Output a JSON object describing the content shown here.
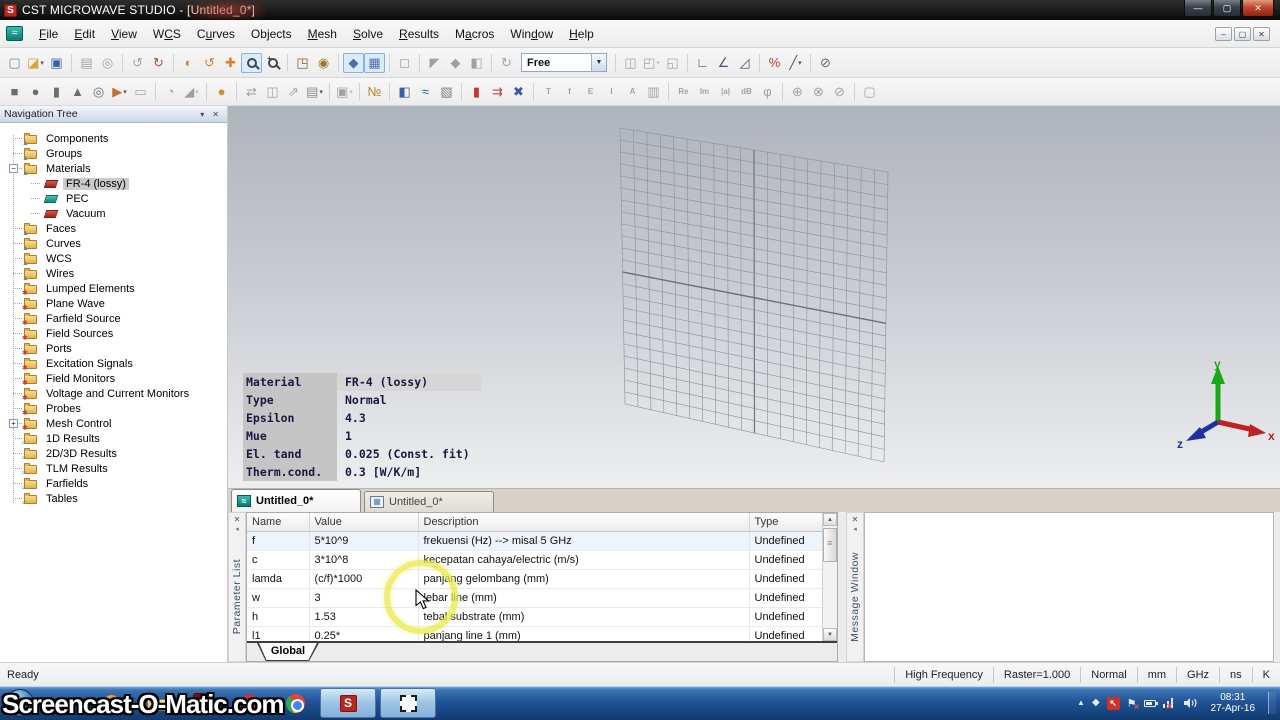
{
  "window": {
    "title": "CST MICROWAVE STUDIO - [Untitled_0*]",
    "controls": [
      "minimize",
      "restore",
      "close"
    ],
    "logo_color": "#c0271e"
  },
  "menu": {
    "items": [
      {
        "label": "File",
        "accel": 0
      },
      {
        "label": "Edit",
        "accel": 0
      },
      {
        "label": "View",
        "accel": 0
      },
      {
        "label": "WCS",
        "accel": 1
      },
      {
        "label": "Curves",
        "accel": 1
      },
      {
        "label": "Objects",
        "accel": 2
      },
      {
        "label": "Mesh",
        "accel": 0
      },
      {
        "label": "Solve",
        "accel": 0
      },
      {
        "label": "Results",
        "accel": 0
      },
      {
        "label": "Macros",
        "accel": 1
      },
      {
        "label": "Window",
        "accel": 3
      },
      {
        "label": "Help",
        "accel": 0
      }
    ]
  },
  "toolbar": {
    "mode_dropdown": "Free",
    "row1": [
      {
        "name": "new-project-icon",
        "glyph": "▢",
        "color": "#7a8694"
      },
      {
        "name": "open-project-icon",
        "glyph": "◪",
        "color": "#d9a43e",
        "caret": true
      },
      {
        "name": "save-project-icon",
        "glyph": "▣",
        "color": "#3a5fa8"
      },
      {
        "sep": true
      },
      {
        "name": "paste-icon",
        "glyph": "▤",
        "disabled": true
      },
      {
        "name": "delete-icon",
        "glyph": "◎",
        "disabled": true
      },
      {
        "sep": true
      },
      {
        "name": "undo-icon",
        "glyph": "↺",
        "disabled": true
      },
      {
        "name": "redo-icon",
        "glyph": "↻",
        "color": "#b5523a"
      },
      {
        "sep": true
      },
      {
        "name": "rotate-view-icon",
        "glyph": "◐",
        "color": "#d9822b"
      },
      {
        "name": "spin-view-icon",
        "glyph": "↺",
        "color": "#d9822b"
      },
      {
        "name": "pan-view-icon",
        "glyph": "✚",
        "color": "#d9822b"
      },
      {
        "name": "zoom-view-icon",
        "mag": true,
        "boxed": true
      },
      {
        "name": "zoom-window-icon",
        "mag": true,
        "plus": true
      },
      {
        "sep": true
      },
      {
        "name": "reset-view-icon",
        "glyph": "◳",
        "color": "#8a5a32"
      },
      {
        "name": "view-options-icon",
        "glyph": "◉",
        "color": "#9a7a2a"
      },
      {
        "sep": true
      },
      {
        "name": "normal-axis-icon",
        "glyph": "◆",
        "color": "#4a6fa5",
        "boxed": true
      },
      {
        "name": "grid-toggle-icon",
        "glyph": "▦",
        "color": "#4a6fa5",
        "boxed": true
      },
      {
        "sep": true
      },
      {
        "name": "wireframe-icon",
        "glyph": "◻",
        "disabled": true
      },
      {
        "sep": true
      },
      {
        "name": "pick-point-icon",
        "glyph": "◤",
        "disabled": true
      },
      {
        "name": "pick-edge-icon",
        "glyph": "◆",
        "disabled": true
      },
      {
        "name": "pick-face-icon",
        "glyph": "◧",
        "disabled": true
      },
      {
        "sep": true
      },
      {
        "name": "transform-view-icon",
        "glyph": "↻",
        "disabled": true
      },
      {
        "select": true
      },
      {
        "sep": true
      },
      {
        "name": "boolean-add-icon",
        "glyph": "◫",
        "disabled": true
      },
      {
        "name": "boolean-subtract-icon",
        "glyph": "◰",
        "disabled": true,
        "caret": true
      },
      {
        "name": "boolean-intersect-icon",
        "glyph": "◱",
        "disabled": true
      },
      {
        "sep": true
      },
      {
        "name": "wcs-icon",
        "glyph": "∟",
        "color": "#445577"
      },
      {
        "name": "align-wcs-icon",
        "glyph": "∠",
        "color": "#445577"
      },
      {
        "name": "wcs-face-icon",
        "glyph": "◿",
        "color": "#445577"
      },
      {
        "sep": true
      },
      {
        "name": "measure-icon",
        "glyph": "%",
        "color": "#c03a2e"
      },
      {
        "name": "pick-line-icon",
        "glyph": "╱",
        "color": "#555555",
        "caret": true
      },
      {
        "sep": true
      },
      {
        "name": "clear-picks-icon",
        "glyph": "⊘",
        "color": "#666666"
      }
    ],
    "row2": [
      {
        "name": "brick-icon",
        "glyph": "■",
        "color": "#686d75"
      },
      {
        "name": "sphere-icon",
        "glyph": "●",
        "color": "#686d75"
      },
      {
        "name": "cylinder-icon",
        "glyph": "▮",
        "color": "#686d75"
      },
      {
        "name": "cone-icon",
        "glyph": "▲",
        "color": "#686d75"
      },
      {
        "name": "torus-icon",
        "glyph": "◎",
        "color": "#686d75"
      },
      {
        "name": "extrude-curve-icon",
        "glyph": "▶",
        "color": "#c2702c",
        "caret": true
      },
      {
        "name": "sheet-icon",
        "glyph": "▭",
        "disabled": true
      },
      {
        "sep": true
      },
      {
        "name": "loft-icon",
        "glyph": "◔",
        "disabled": true
      },
      {
        "name": "shell-icon",
        "glyph": "◢",
        "disabled": true,
        "caret": true
      },
      {
        "sep": true
      },
      {
        "name": "new-material-icon",
        "glyph": "●",
        "color": "#d98a2b"
      },
      {
        "sep": true
      },
      {
        "name": "translate-icon",
        "glyph": "⇄",
        "disabled": true
      },
      {
        "name": "mirror-icon",
        "glyph": "◫",
        "disabled": true
      },
      {
        "name": "scale-icon",
        "glyph": "⇗",
        "disabled": true
      },
      {
        "name": "align-icon",
        "glyph": "▤",
        "color": "#8a8f96",
        "caret": true
      },
      {
        "sep": true
      },
      {
        "name": "group-icon",
        "glyph": "▣",
        "disabled": true,
        "caret": true
      },
      {
        "sep": true
      },
      {
        "name": "units-ruler-icon",
        "glyph": "№",
        "color": "#b8862b"
      },
      {
        "sep": true
      },
      {
        "name": "project-settings-icon",
        "glyph": "◧",
        "color": "#3a5fa8"
      },
      {
        "name": "frequency-icon",
        "glyph": "≈",
        "color": "#2a65c8"
      },
      {
        "name": "background-icon",
        "glyph": "▧",
        "color": "#7a8088"
      },
      {
        "sep": true
      },
      {
        "name": "boundary-icon",
        "glyph": "▮",
        "color": "#c03a2e"
      },
      {
        "name": "plane-wave-icon",
        "glyph": "⇉",
        "color": "#b04848"
      },
      {
        "name": "discrete-port-icon",
        "glyph": "✖",
        "color": "#3a55b0"
      },
      {
        "sep": true
      },
      {
        "name": "time-monitor-icon",
        "glyph": "T",
        "disabled": true,
        "small": true
      },
      {
        "name": "freq-monitor-icon",
        "glyph": "f",
        "disabled": true,
        "small": true
      },
      {
        "name": "efield-monitor-icon",
        "glyph": "E",
        "disabled": true,
        "small": true
      },
      {
        "name": "current-monitor-icon",
        "glyph": "I",
        "disabled": true,
        "small": true
      },
      {
        "name": "farfield-monitor-icon",
        "glyph": "A",
        "disabled": true,
        "small": true
      },
      {
        "name": "tlm-monitor-icon",
        "glyph": "▥",
        "disabled": true
      },
      {
        "sep": true
      },
      {
        "name": "result-real-icon",
        "glyph": "Re",
        "disabled": true,
        "small": true
      },
      {
        "name": "result-imag-icon",
        "glyph": "Im",
        "disabled": true,
        "small": true
      },
      {
        "name": "result-magnitude-icon",
        "glyph": "|a|",
        "disabled": true,
        "small": true
      },
      {
        "name": "result-db-icon",
        "glyph": "dB",
        "disabled": true,
        "small": true
      },
      {
        "name": "result-phase-icon",
        "glyph": "φ",
        "disabled": true
      },
      {
        "sep": true
      },
      {
        "name": "smith-chart-icon",
        "glyph": "⊕",
        "disabled": true
      },
      {
        "name": "polar-plot-icon",
        "glyph": "⊗",
        "disabled": true
      },
      {
        "name": "plot-3d-icon",
        "glyph": "⊘",
        "disabled": true
      },
      {
        "sep": true
      },
      {
        "name": "template-results-icon",
        "glyph": "▢",
        "disabled": true
      }
    ]
  },
  "navigation_tree": {
    "title": "Navigation Tree",
    "items": [
      {
        "label": "Components",
        "icon": "folder-component-icon",
        "level": 1
      },
      {
        "label": "Groups",
        "icon": "folder-component-icon",
        "level": 1
      },
      {
        "label": "Materials",
        "icon": "folder-component-icon",
        "level": 1,
        "expand": "minus"
      },
      {
        "label": "FR-4 (lossy)",
        "icon": "material-lossy-icon",
        "level": 2,
        "selected": true
      },
      {
        "label": "PEC",
        "icon": "material-pec-icon",
        "level": 2
      },
      {
        "label": "Vacuum",
        "icon": "material-lossy-icon",
        "level": 2
      },
      {
        "label": "Faces",
        "icon": "folder-component-icon",
        "level": 1
      },
      {
        "label": "Curves",
        "icon": "folder-component-icon",
        "level": 1
      },
      {
        "label": "WCS",
        "icon": "folder-component-icon",
        "level": 1
      },
      {
        "label": "Wires",
        "icon": "folder-component-icon",
        "level": 1
      },
      {
        "label": "Lumped Elements",
        "icon": "folder-source-icon",
        "level": 1
      },
      {
        "label": "Plane Wave",
        "icon": "folder-source-icon",
        "level": 1
      },
      {
        "label": "Farfield Source",
        "icon": "folder-source-icon",
        "level": 1
      },
      {
        "label": "Field Sources",
        "icon": "folder-source-icon",
        "level": 1
      },
      {
        "label": "Ports",
        "icon": "folder-source-icon",
        "level": 1
      },
      {
        "label": "Excitation Signals",
        "icon": "folder-source-icon",
        "level": 1
      },
      {
        "label": "Field Monitors",
        "icon": "folder-source-icon",
        "level": 1
      },
      {
        "label": "Voltage and Current Monitors",
        "icon": "folder-source-icon",
        "level": 1
      },
      {
        "label": "Probes",
        "icon": "folder-source-icon",
        "level": 1
      },
      {
        "label": "Mesh Control",
        "icon": "folder-source-icon",
        "level": 1,
        "expand": "plus"
      },
      {
        "label": "1D Results",
        "icon": "folder-results-icon",
        "level": 1
      },
      {
        "label": "2D/3D Results",
        "icon": "folder-results-icon",
        "level": 1
      },
      {
        "label": "TLM Results",
        "icon": "folder-results-icon",
        "level": 1
      },
      {
        "label": "Farfields",
        "icon": "folder-results-icon",
        "level": 1
      },
      {
        "label": "Tables",
        "icon": "folder-results-icon",
        "level": 1
      }
    ]
  },
  "material_info": {
    "rows": [
      [
        "Material",
        "FR-4 (lossy)"
      ],
      [
        "Type",
        "Normal"
      ],
      [
        "Epsilon",
        "4.3"
      ],
      [
        "Mue",
        "1"
      ],
      [
        "El. tand",
        "0.025 (Const. fit)"
      ],
      [
        "Therm.cond.",
        "0.3 [W/K/m]"
      ]
    ]
  },
  "axes_widget": {
    "x_label": "x",
    "y_label": "y",
    "z_label": "z",
    "x_color": "#c02020",
    "y_color": "#18a818",
    "z_color": "#2030a0"
  },
  "document_tabs": [
    {
      "label": "Untitled_0*",
      "icon": "modeler-wave-icon",
      "active": true
    },
    {
      "label": "Untitled_0*",
      "icon": "schematic-icon",
      "active": false
    }
  ],
  "parameter_list": {
    "strip_label": "Parameter List",
    "columns": [
      "Name",
      "Value",
      "Description",
      "Type"
    ],
    "rows": [
      [
        "f",
        "5*10^9",
        "frekuensi (Hz) --> misal 5 GHz",
        "Undefined"
      ],
      [
        "c",
        "3*10^8",
        "kecepatan cahaya/electric (m/s)",
        "Undefined"
      ],
      [
        "lamda",
        "(c/f)*1000",
        "panjang gelombang (mm)",
        "Undefined"
      ],
      [
        "w",
        "3",
        "lebar line (mm)",
        "Undefined"
      ],
      [
        "h",
        "1.53",
        "tebal substrate (mm)",
        "Undefined"
      ],
      [
        "l1",
        "0.25*",
        "panjang line 1 (mm)",
        "Undefined"
      ]
    ],
    "tab": "Global"
  },
  "message_window": {
    "strip_label": "Message Window"
  },
  "status_bar": {
    "left": "Ready",
    "items": [
      "High Frequency",
      "Raster=1.000",
      "Normal",
      "mm",
      "GHz",
      "ns",
      "K"
    ]
  },
  "taskbar": {
    "watermark": "Screencast-O-Matic.com",
    "clock_time": "08:31",
    "clock_date": "27-Apr-16",
    "pinned_icons": [
      "start-orb",
      "internet-explorer-icon",
      "orange-app-icon",
      "explorer-folder-icon",
      "adobe-reader-icon",
      "opera-icon",
      "chrome-icon",
      "cst-studio-taskbar-button",
      "screen-marquee-taskbar-button"
    ],
    "tray_icons": [
      "tray-expand-icon",
      "dropbox-icon",
      "recorder-icon",
      "action-center-flag-icon",
      "battery-icon",
      "network-icon",
      "volume-icon"
    ]
  },
  "highlight": {
    "color": "#e9e946"
  }
}
